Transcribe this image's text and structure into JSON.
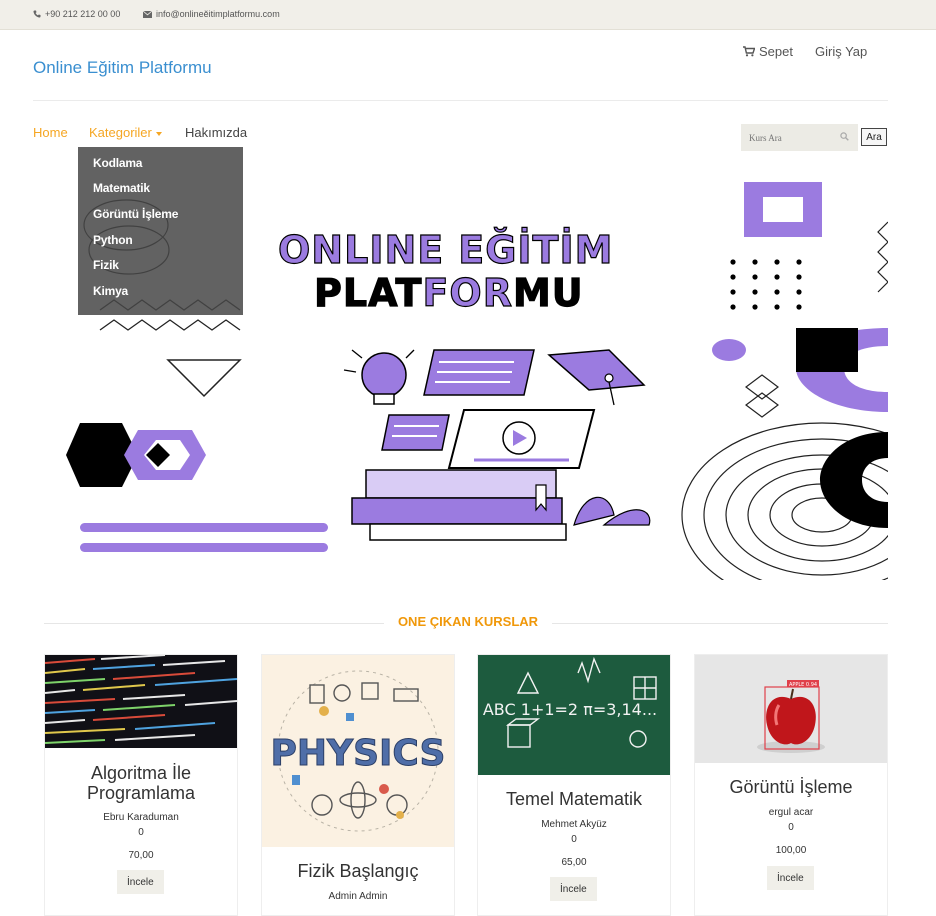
{
  "topbar": {
    "phone": "+90 212 212 00 00",
    "email": "info@onlineĕitimplatformu.com",
    "phone_icon": "phone-icon",
    "email_icon": "envelope-icon"
  },
  "header": {
    "brand": "Online Eğitim Platformu",
    "cart_label": "Sepet",
    "cart_icon": "cart-icon",
    "login_label": "Giriş Yap"
  },
  "nav": {
    "home": "Home",
    "categories": "Kategoriler",
    "about": "Hakımızda",
    "dropdown": [
      "Kodlama",
      "Matematik",
      "Görüntü İşleme",
      "Python",
      "Fizik",
      "Kimya"
    ]
  },
  "search": {
    "placeholder": "Kurs Ara",
    "button": "Ara",
    "icon": "search-icon"
  },
  "hero": {
    "line1a": "ONLINE",
    "line1b": "EĞİTİM",
    "line2a": "PLAT",
    "line2b": "FOR",
    "line2c": "MU"
  },
  "colors": {
    "accent_orange": "#f5a623",
    "section_orange": "#f0980a",
    "brand_blue": "#3a8fd0",
    "hero_purple": "#9b7be0"
  },
  "section": {
    "title": "ONE ÇIKAN KURSLAR"
  },
  "courses": [
    {
      "title_line1": "Algoritma İle",
      "title_line2": "Programlama",
      "instructor": "Ebru Karaduman",
      "count": "0",
      "price": "70,00",
      "button": "İncele"
    },
    {
      "title": "Fizik Başlangıç",
      "instructor": "Admin Admin",
      "image_text": "PHYSICS"
    },
    {
      "title": "Temel Matematik",
      "instructor": "Mehmet Akyüz",
      "count": "0",
      "price": "65,00",
      "button": "İncele",
      "image_text": "ABC 1+1=2 π=3,14..."
    },
    {
      "title": "Görüntü İşleme",
      "instructor": "ergul acar",
      "count": "0",
      "price": "100,00",
      "button": "İncele",
      "image_text": "APPLE 0.94"
    }
  ]
}
